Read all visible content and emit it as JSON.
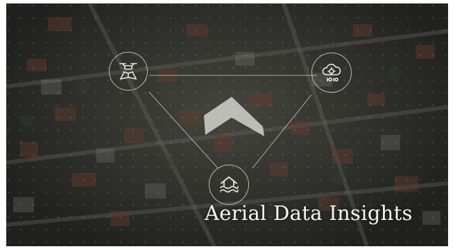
{
  "title": "Aerial Data Insights",
  "icons": {
    "drone": "drone-map-icon",
    "cloud": "cloud-data-icon",
    "flood": "flood-house-icon",
    "center": "drone-silhouette-icon"
  },
  "colors": {
    "overlay": "#2b2b28",
    "line": "#d8d8d2",
    "title": "#f5f5f2"
  }
}
